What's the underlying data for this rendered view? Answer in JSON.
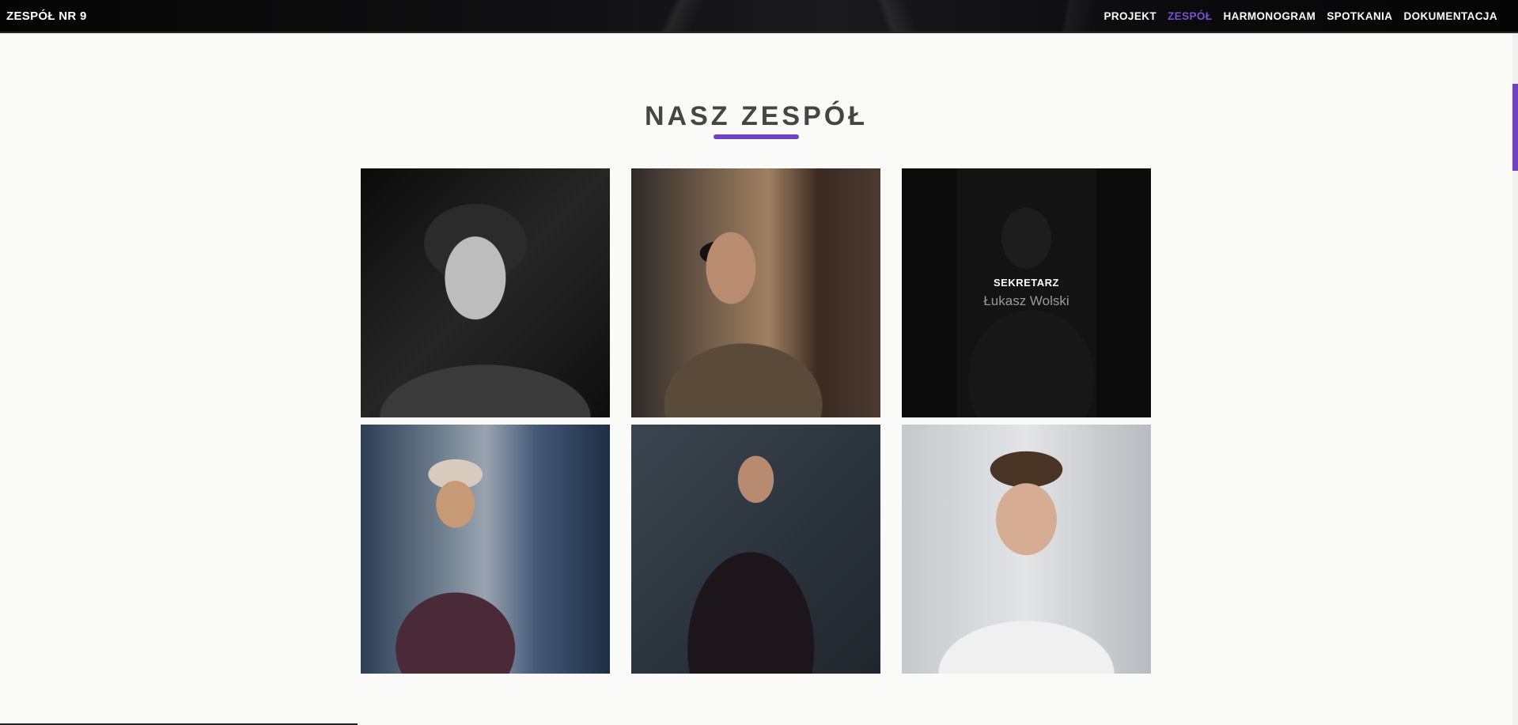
{
  "navbar": {
    "brand": "ZESPÓŁ NR 9",
    "links": [
      {
        "label": "PROJEKT",
        "active": false
      },
      {
        "label": "ZESPÓŁ",
        "active": true
      },
      {
        "label": "HARMONOGRAM",
        "active": false
      },
      {
        "label": "SPOTKANIA",
        "active": false
      },
      {
        "label": "DOKUMENTACJA",
        "active": false
      }
    ]
  },
  "section": {
    "title": "NASZ ZESPÓŁ"
  },
  "team": [
    {
      "photo": "portrait-curly-hair-bw-photo"
    },
    {
      "photo": "portrait-glasses-turtleneck-photo"
    },
    {
      "photo": "portrait-secretary-photo",
      "role": "SEKRETARZ",
      "name": "Łukasz Wolski",
      "hovered": true
    },
    {
      "photo": "portrait-hat-scarf-photo"
    },
    {
      "photo": "portrait-suit-photo"
    },
    {
      "photo": "portrait-glasses-white-tee-photo"
    }
  ],
  "colors": {
    "accent": "#6f42c1",
    "nav_active": "#7b4fd6",
    "title": "#454545",
    "background": "#fafaf8"
  }
}
